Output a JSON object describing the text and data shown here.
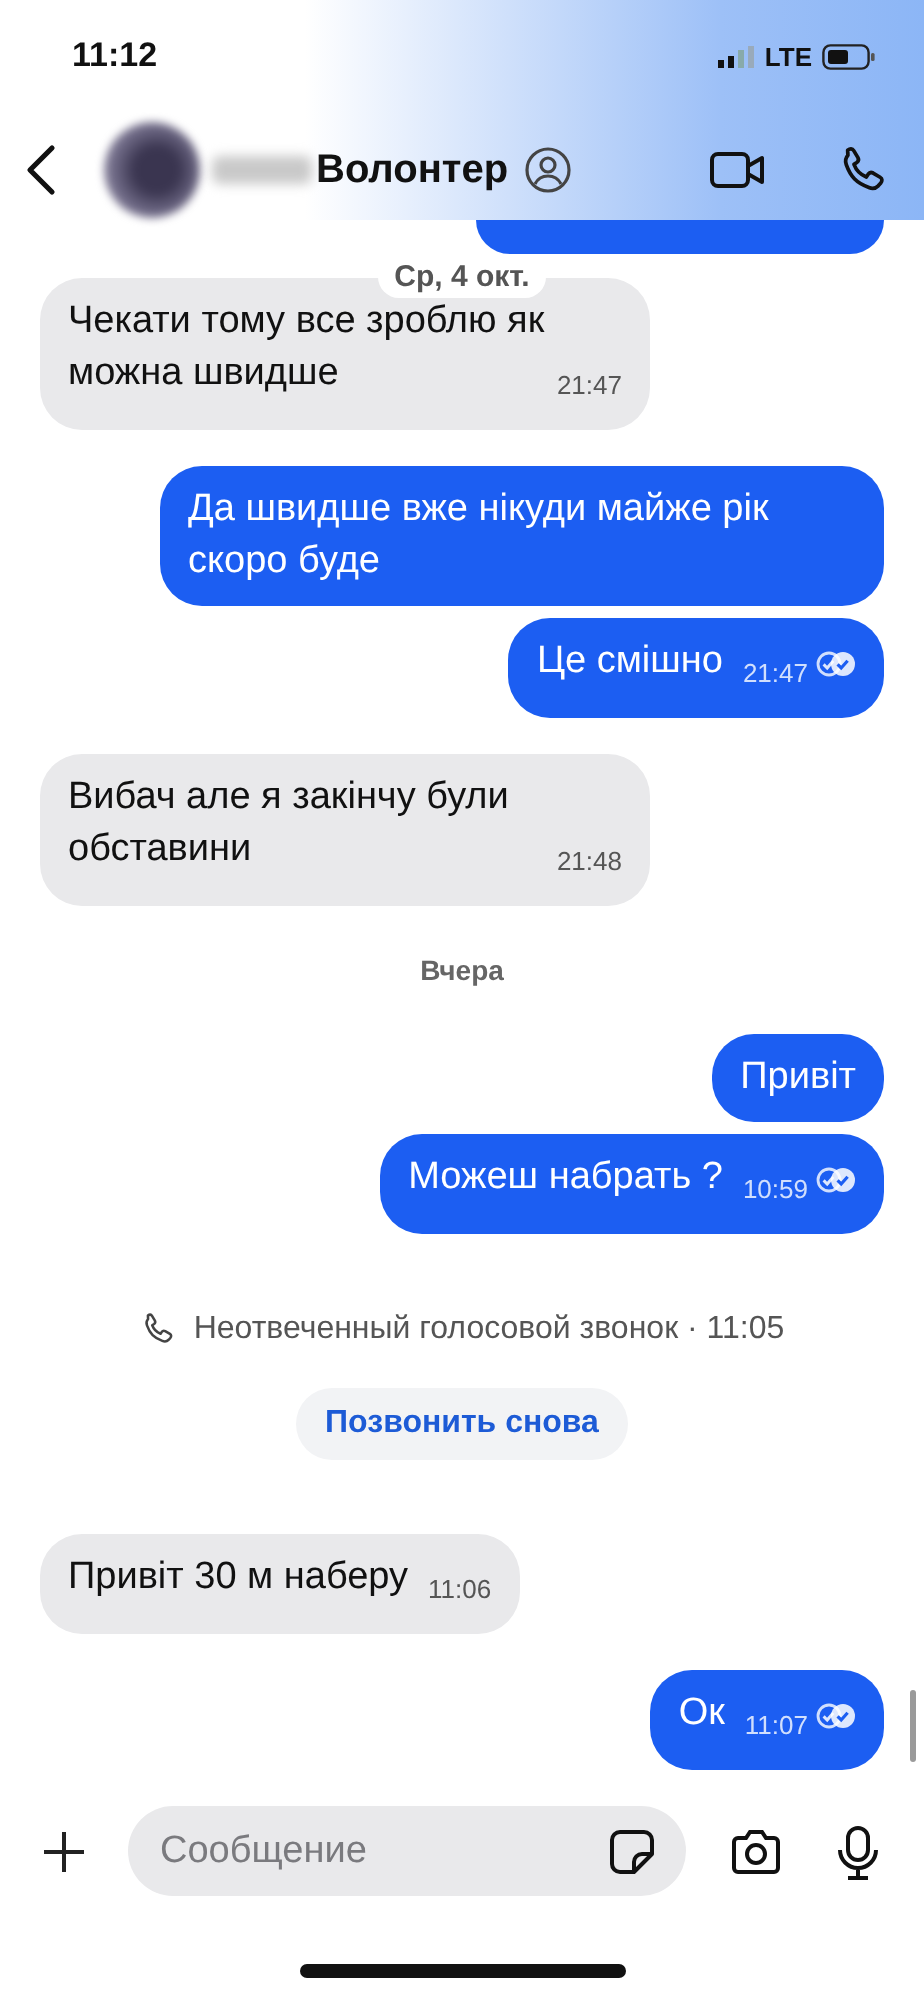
{
  "status_bar": {
    "time": "11:12",
    "network": "LTE"
  },
  "header": {
    "name": "Волонтер"
  },
  "messages": [
    {
      "kind": "clipped"
    },
    {
      "kind": "date",
      "text": "Ср, 4 окт."
    },
    {
      "kind": "incoming",
      "text": "Чекати тому все зроблю як можна швидше",
      "time": "21:47"
    },
    {
      "kind": "outgoing",
      "text": "Да швидше вже нікуди майже рік скоро буде",
      "read": false
    },
    {
      "kind": "outgoing",
      "text": "Це смішно",
      "time": "21:47",
      "read": true
    },
    {
      "kind": "incoming",
      "text": "Вибач але я закінчу були обставини",
      "time": "21:48"
    },
    {
      "kind": "day",
      "text": "Вчера"
    },
    {
      "kind": "outgoing",
      "text": "Привіт",
      "read": false
    },
    {
      "kind": "outgoing",
      "text": "Можеш набрать ?",
      "time": "10:59",
      "read": true
    },
    {
      "kind": "missed_call",
      "text": "Неотвеченный голосовой звонок · 11:05",
      "action": "Позвонить снова"
    },
    {
      "kind": "incoming",
      "text": "Привіт 30 м наберу",
      "time": "11:06"
    },
    {
      "kind": "outgoing",
      "text": "Ок",
      "time": "11:07",
      "read": true
    }
  ],
  "composer": {
    "placeholder": "Сообщение"
  }
}
